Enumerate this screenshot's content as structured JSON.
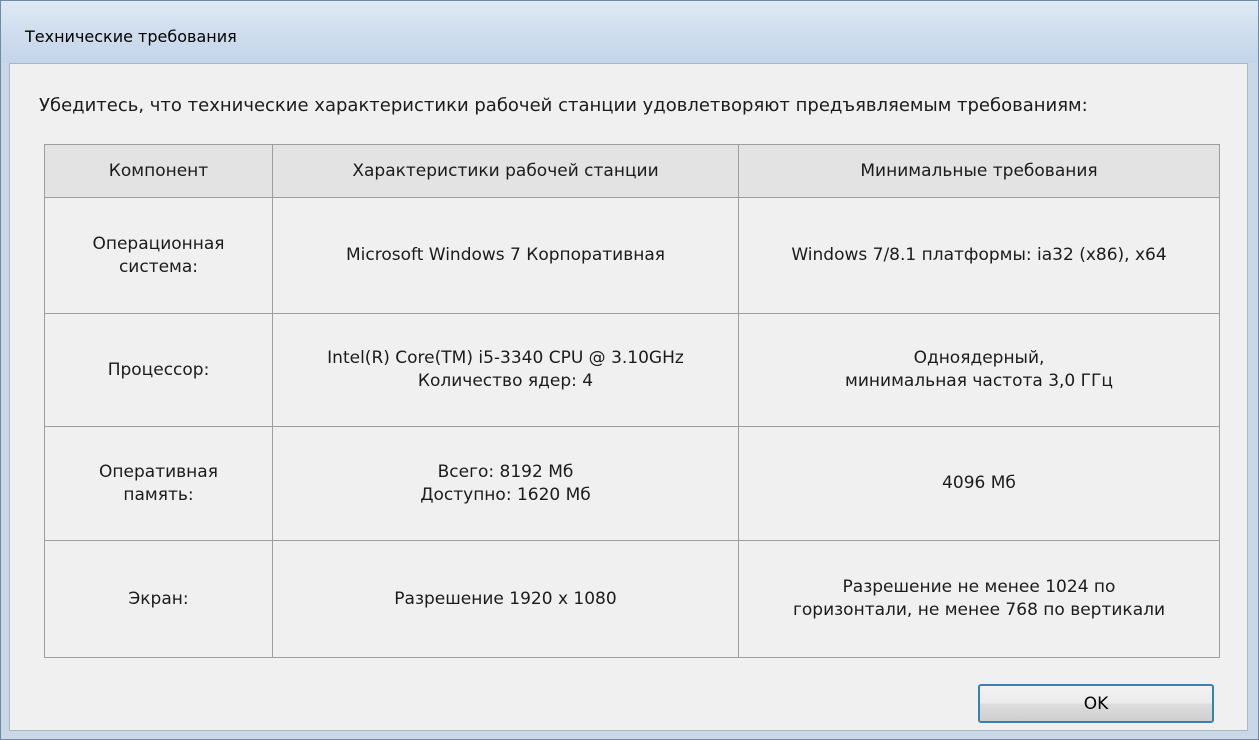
{
  "window": {
    "title": "Технические требования"
  },
  "dialog": {
    "intro": "Убедитесь, что технические характеристики рабочей станции удовлетворяют предъявляемым требованиям:",
    "headers": [
      "Компонент",
      "Характеристики рабочей станции",
      "Минимальные требования"
    ],
    "rows": [
      {
        "component": "Операционная\nсистема:",
        "workstation": "Microsoft Windows 7 Корпоративная",
        "minimum": "Windows 7/8.1 платформы: ia32 (x86), x64"
      },
      {
        "component": "Процессор:",
        "workstation": "Intel(R) Core(TM) i5-3340 CPU @ 3.10GHz\nКоличество ядер: 4",
        "minimum": "Одноядерный,\nминимальная частота 3,0 ГГц"
      },
      {
        "component": "Оперативная\nпамять:",
        "workstation": "Всего: 8192 Мб\nДоступно: 1620 Мб",
        "minimum": "4096 Мб"
      },
      {
        "component": "Экран:",
        "workstation": "Разрешение 1920 x 1080",
        "minimum": "Разрешение не менее 1024 по\nгоризонтали, не менее 768 по вертикали"
      }
    ],
    "ok_label": "OK"
  },
  "colors": {
    "focus_border": "#3c7fb1",
    "header_bg": "#e3e3e3",
    "dialog_bg": "#f0f0f0"
  }
}
